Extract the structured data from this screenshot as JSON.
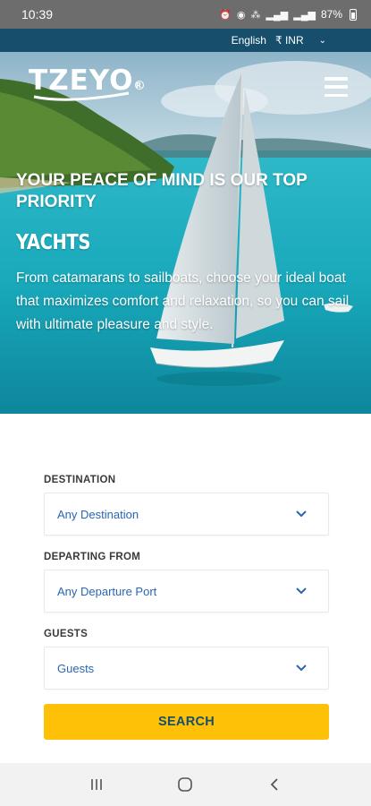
{
  "status_bar": {
    "time": "10:39",
    "battery": "87%",
    "icons": [
      "alarm-icon",
      "wifi-calling-icon",
      "volte-icon",
      "signal-icon",
      "signal-icon",
      "battery-icon"
    ]
  },
  "top_bar": {
    "language": "English",
    "currency": "₹ INR"
  },
  "hero": {
    "logo": "TZEYO",
    "title": "YOUR PEACE OF MIND IS OUR TOP PRIORITY",
    "subtitle": "YACHTS",
    "description": "From catamarans to sailboats, choose your ideal boat that maximizes comfort and relaxation, so you can sail with ultimate pleasure and style."
  },
  "search": {
    "destination_label": "DESTINATION",
    "destination_value": "Any Destination",
    "departing_label": "DEPARTING FROM",
    "departing_value": "Any Departure Port",
    "guests_label": "GUESTS",
    "guests_value": "Guests",
    "button_label": "SEARCH"
  },
  "colors": {
    "brand_dark": "#164e6b",
    "accent_yellow": "#ffc107",
    "link_blue": "#2a66b4"
  }
}
